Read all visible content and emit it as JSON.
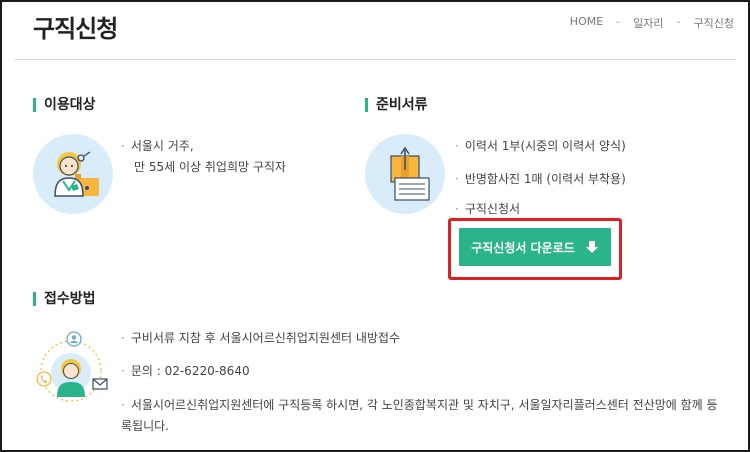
{
  "header": {
    "title": "구직신청",
    "breadcrumb": [
      "HOME",
      "일자리",
      "구직신청"
    ],
    "separator": "-"
  },
  "eligibility": {
    "heading": "이용대상",
    "lines": [
      "서울시 거주,",
      "만 55세 이상 취업희망 구직자"
    ]
  },
  "documents": {
    "heading": "준비서류",
    "items": [
      "이력서 1부(시중의 이력서 양식)",
      "반명함사진 1매 (이력서 부착용)",
      "구직신청서"
    ],
    "download_label": "구직신청서 다운로드"
  },
  "application": {
    "heading": "접수방법",
    "items": [
      "구비서류 지참 후 서울시어르신취업지원센터 내방접수",
      "문의 : 02-6220-8640",
      "서울시어르신취업지원센터에 구직등록 하시면, 각 노인종합복지관 및 자치구, 서울일자리플러스센터 전산망에 함께 등록됩니다."
    ]
  },
  "colors": {
    "accent": "#2bb48b",
    "highlight": "#e02020",
    "illustration_bg": "#d9ecf9"
  },
  "icons": [
    "woman-with-key-icon",
    "document-stack-icon",
    "contact-woman-icon",
    "download-arrow-icon"
  ]
}
